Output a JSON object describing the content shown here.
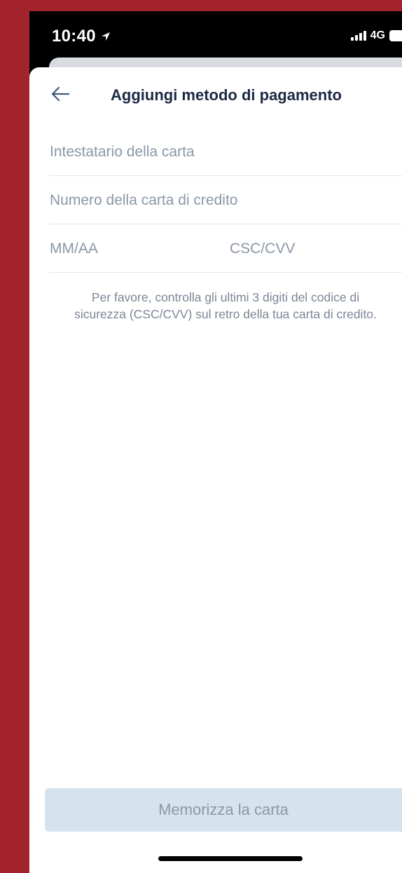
{
  "status_bar": {
    "time": "10:40",
    "network": "4G",
    "location_icon": "location-arrow-icon",
    "signal_icon": "signal-bars-icon",
    "battery_icon": "battery-icon"
  },
  "header": {
    "title": "Aggiungi metodo di pagamento",
    "back_icon": "arrow-left-icon"
  },
  "form": {
    "cardholder_placeholder": "Intestatario della carta",
    "card_number_placeholder": "Numero della carta di credito",
    "expiry_placeholder": "MM/AA",
    "csc_placeholder": "CSC/CVV"
  },
  "help_text": {
    "line1": "Per favore, controlla gli ultimi 3 digiti del codice di",
    "line2": "sicurezza (CSC/CVV) sul retro della tua carta di credito."
  },
  "save_button": {
    "label": "Memorizza la carta"
  },
  "colors": {
    "background": "#a3232d",
    "title": "#1c2a44",
    "placeholder": "#8b97a6",
    "button_bg": "#d7e3ec",
    "button_text": "#8c98a6"
  }
}
